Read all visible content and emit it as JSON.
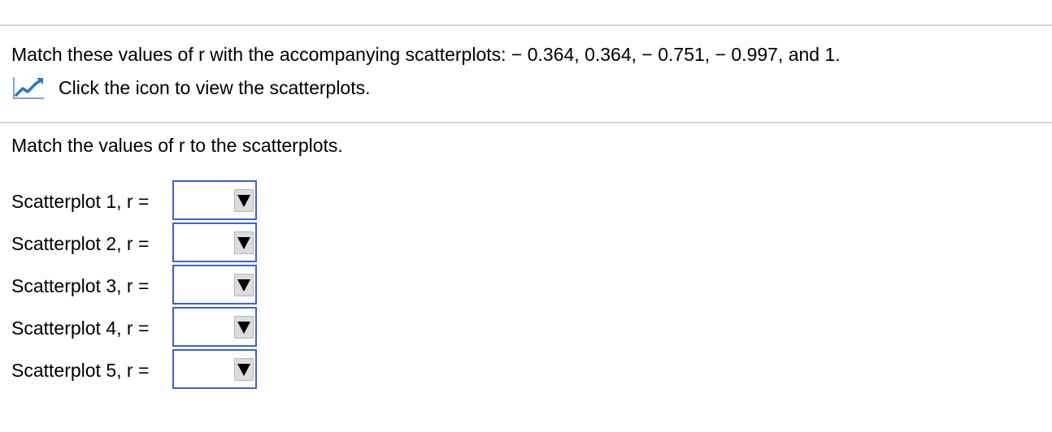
{
  "question": {
    "text": "Match these values of r with the accompanying scatterplots:  − 0.364, 0.364,  − 0.751,  − 0.997, and 1.",
    "icon_link_text": "Click the icon to view the scatterplots.",
    "icon": "line-chart-icon"
  },
  "instruction": "Match the values of r to the scatterplots.",
  "matches": [
    {
      "label": "Scatterplot 1, r =",
      "selected": ""
    },
    {
      "label": "Scatterplot 2, r =",
      "selected": ""
    },
    {
      "label": "Scatterplot 3, r =",
      "selected": ""
    },
    {
      "label": "Scatterplot 4, r =",
      "selected": ""
    },
    {
      "label": "Scatterplot 5, r =",
      "selected": ""
    }
  ],
  "colors": {
    "divider": "#d6d6de",
    "select_border": "#3b63c4",
    "icon_blue": "#2a73c9"
  }
}
